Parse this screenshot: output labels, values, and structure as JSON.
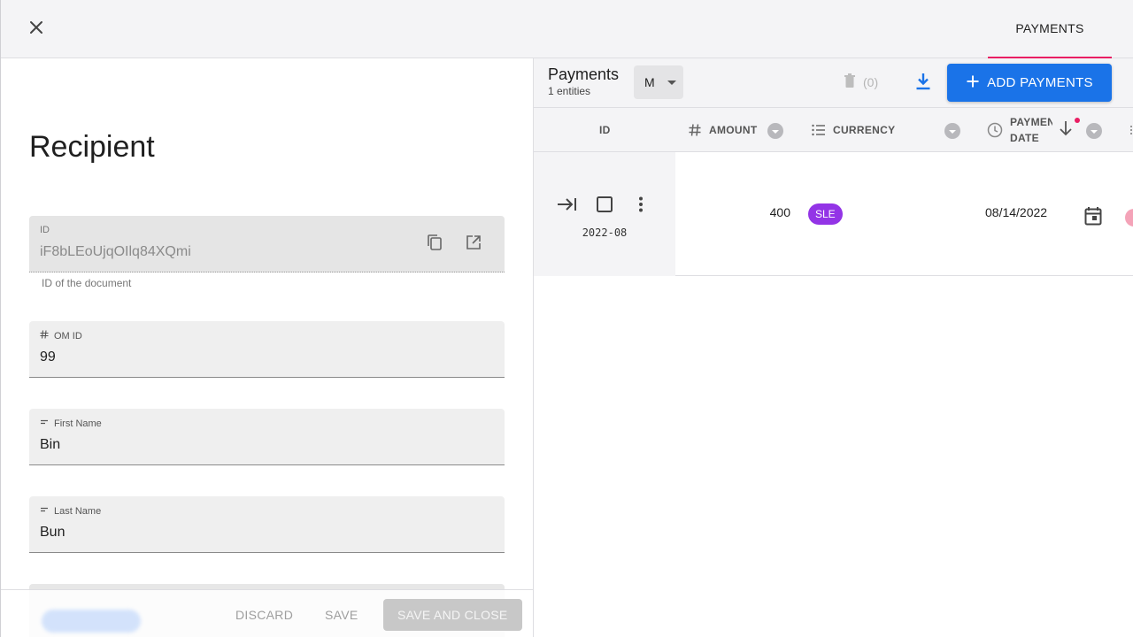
{
  "header": {
    "tab_label": "PAYMENTS"
  },
  "form": {
    "title": "Recipient",
    "fields": [
      {
        "label": "ID",
        "value": "iF8bLEoUjqOIlq84XQmi",
        "helper": "ID of the document",
        "icon": "none",
        "disabled": true
      },
      {
        "label": "OM ID",
        "value": "99",
        "icon": "hash-icon",
        "disabled": false
      },
      {
        "label": "First Name",
        "value": "Bin",
        "icon": "short-text-icon",
        "disabled": false
      },
      {
        "label": "Last Name",
        "value": "Bun",
        "icon": "short-text-icon",
        "disabled": false
      }
    ]
  },
  "footer": {
    "discard": "DISCARD",
    "save": "SAVE",
    "save_close": "SAVE AND CLOSE"
  },
  "table": {
    "title": "Payments",
    "subtitle": "1 entities",
    "size_selected": "M",
    "delete_count": "(0)",
    "add_label": "ADD PAYMENTS",
    "columns": [
      {
        "label": "ID",
        "icon": "none"
      },
      {
        "label": "AMOUNT",
        "icon": "hash-icon"
      },
      {
        "label": "CURRENCY",
        "icon": "list-icon"
      },
      {
        "label_line1": "PAYMEN",
        "label_line2": "DATE",
        "icon": "clock-icon",
        "sort": "descending"
      }
    ],
    "rows": [
      {
        "id": "2022-08",
        "amount": "400",
        "currency": "SLE",
        "payment_date": "08/14/2022"
      }
    ],
    "colors": {
      "accent_blue": "#1a73e8",
      "tab_underline": "#e91e63",
      "currency_chip": "#9334e6"
    }
  }
}
